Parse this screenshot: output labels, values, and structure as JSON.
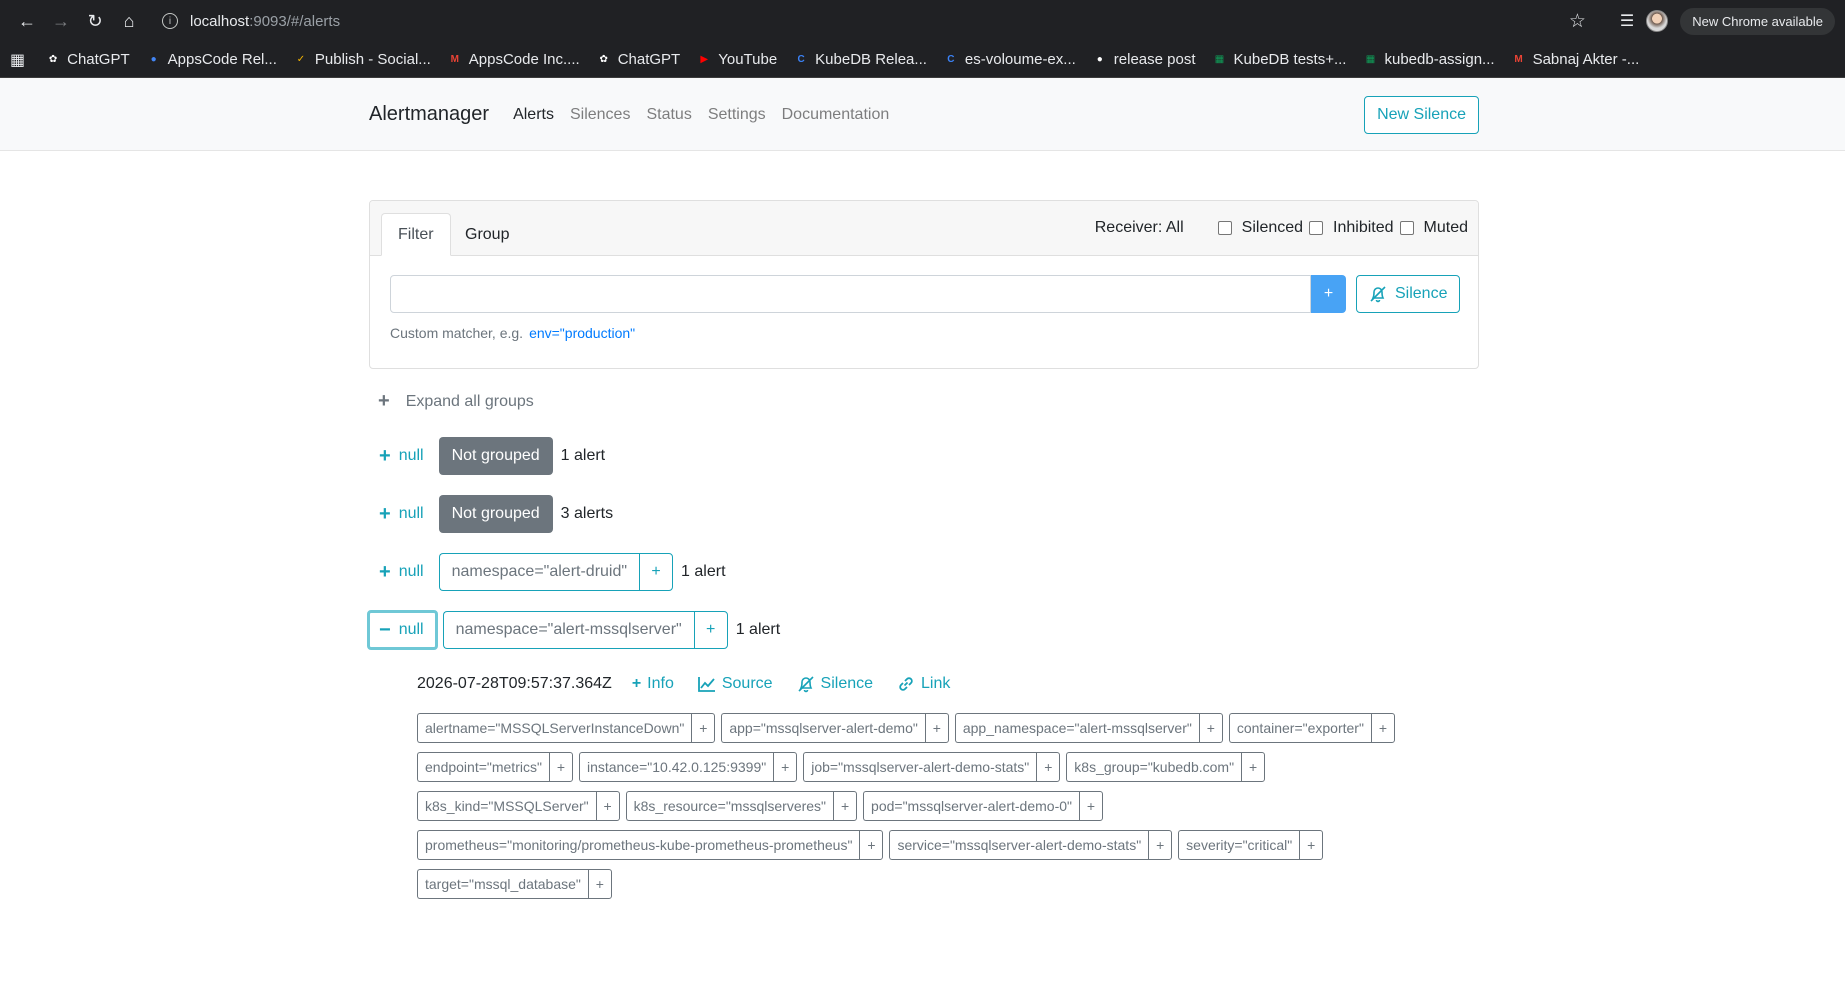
{
  "browser": {
    "url_host": "localhost",
    "url_rest": ":9093/#/alerts",
    "update_label": "New Chrome available",
    "bookmarks": [
      {
        "label": "ChatGPT",
        "icon": "chatgpt-icon",
        "color": "#ffffff"
      },
      {
        "label": "AppsCode Rel...",
        "icon": "people-icon",
        "color": "#4285f4"
      },
      {
        "label": "Publish - Social...",
        "icon": "publish-icon",
        "color": "#f4b400"
      },
      {
        "label": "AppsCode Inc....",
        "icon": "gmail-icon",
        "color": "#ea4335"
      },
      {
        "label": "ChatGPT",
        "icon": "chatgpt-icon",
        "color": "#ffffff"
      },
      {
        "label": "YouTube",
        "icon": "youtube-icon",
        "color": "#ff0000"
      },
      {
        "label": "KubeDB Relea...",
        "icon": "c-icon",
        "color": "#3b82f6"
      },
      {
        "label": "es-voloume-ex...",
        "icon": "c-icon",
        "color": "#3b82f6"
      },
      {
        "label": "release post",
        "icon": "github-icon",
        "color": "#ffffff"
      },
      {
        "label": "KubeDB tests+...",
        "icon": "sheets-icon",
        "color": "#0f9d58"
      },
      {
        "label": "kubedb-assign...",
        "icon": "sheets-icon",
        "color": "#0f9d58"
      },
      {
        "label": "Sabnaj Akter -...",
        "icon": "gmail-icon",
        "color": "#ea4335"
      }
    ]
  },
  "navbar": {
    "brand": "Alertmanager",
    "links": [
      "Alerts",
      "Silences",
      "Status",
      "Settings",
      "Documentation"
    ],
    "active": "Alerts",
    "new_silence": "New Silence"
  },
  "filter": {
    "tabs": [
      "Filter",
      "Group"
    ],
    "receiver": "Receiver: All",
    "checkboxes": [
      "Silenced",
      "Inhibited",
      "Muted"
    ],
    "input_value": "",
    "plus_label": "+",
    "silence_label": "Silence",
    "hint_text": "Custom matcher, e.g.",
    "hint_example": "env=\"production\""
  },
  "expand_all": "Expand all groups",
  "groups": [
    {
      "toggle": "null",
      "badge": "Not grouped",
      "count": "1 alert"
    },
    {
      "toggle": "null",
      "badge": "Not grouped",
      "count": "3 alerts"
    },
    {
      "toggle": "null",
      "label": "namespace=\"alert-druid\"",
      "count": "1 alert"
    },
    {
      "toggle": "null",
      "label": "namespace=\"alert-mssqlserver\"",
      "count": "1 alert"
    }
  ],
  "alert": {
    "timestamp": "2026-07-28T09:57:37.364Z",
    "actions": [
      "Info",
      "Source",
      "Silence",
      "Link"
    ],
    "labels": [
      "alertname=\"MSSQLServerInstanceDown\"",
      "app=\"mssqlserver-alert-demo\"",
      "app_namespace=\"alert-mssqlserver\"",
      "container=\"exporter\"",
      "endpoint=\"metrics\"",
      "instance=\"10.42.0.125:9399\"",
      "job=\"mssqlserver-alert-demo-stats\"",
      "k8s_group=\"kubedb.com\"",
      "k8s_kind=\"MSSQLServer\"",
      "k8s_resource=\"mssqlserveres\"",
      "pod=\"mssqlserver-alert-demo-0\"",
      "prometheus=\"monitoring/prometheus-kube-prometheus-prometheus\"",
      "service=\"mssqlserver-alert-demo-stats\"",
      "severity=\"critical\"",
      "target=\"mssql_database\""
    ]
  },
  "colors": {
    "accent": "#17a2b8",
    "primary_btn": "#48a3f5",
    "badge": "#6c757d"
  }
}
